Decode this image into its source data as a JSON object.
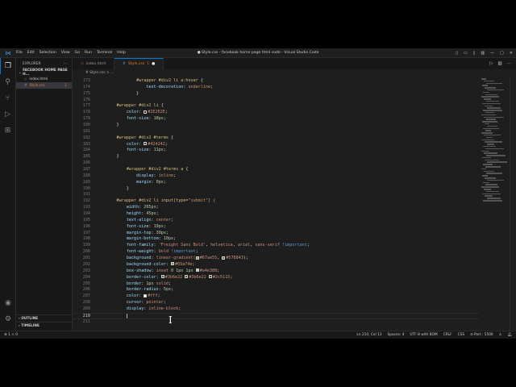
{
  "menu": [
    "File",
    "Edit",
    "Selection",
    "View",
    "Go",
    "Run",
    "Terminal",
    "Help"
  ],
  "window_title": "● Style.css - facebook home page html code - Visual Studio Code",
  "sidebar": {
    "title": "EXPLORER",
    "more": "···",
    "folder": "FACEBOOK HOME PAGE H...",
    "files": [
      {
        "name": "index.html",
        "icon": "◇"
      },
      {
        "name": "Style.css",
        "icon": "#",
        "badge": "1"
      }
    ],
    "outline": "OUTLINE",
    "timeline": "TIMELINE"
  },
  "tabs": [
    {
      "label": "index.html",
      "icon": "◇"
    },
    {
      "label": "Style.css",
      "badge": "1",
      "dirty": "●"
    }
  ],
  "breadcrumb": "# Style.css > ...",
  "code": [
    {
      "n": "173",
      "i": 16,
      "t": [
        [
          "#wrapper #div2 li a:hover ",
          "sel"
        ],
        [
          "{",
          "p"
        ]
      ]
    },
    {
      "n": "174",
      "i": 20,
      "t": [
        [
          "text-decoration",
          "prop"
        ],
        [
          ": ",
          "p"
        ],
        [
          "underline",
          "val"
        ],
        [
          ";",
          "p"
        ]
      ]
    },
    {
      "n": "175",
      "i": 16,
      "t": [
        [
          "}",
          "p"
        ]
      ]
    },
    {
      "n": "176",
      "i": 0,
      "t": []
    },
    {
      "n": "177",
      "i": 8,
      "t": [
        [
          "#wrapper #div2 li ",
          "sel"
        ],
        [
          "{",
          "p"
        ]
      ]
    },
    {
      "n": "178",
      "i": 12,
      "t": [
        [
          "color",
          "prop"
        ],
        [
          ": ",
          "p"
        ],
        [
          "#2E2E2E",
          "val",
          "#2E2E2E"
        ],
        [
          ";",
          "p"
        ]
      ]
    },
    {
      "n": "179",
      "i": 12,
      "t": [
        [
          "font-size",
          "prop"
        ],
        [
          ": ",
          "p"
        ],
        [
          "18px",
          "num"
        ],
        [
          ";",
          "p"
        ]
      ]
    },
    {
      "n": "180",
      "i": 8,
      "t": [
        [
          "}",
          "p"
        ]
      ]
    },
    {
      "n": "181",
      "i": 0,
      "t": []
    },
    {
      "n": "182",
      "i": 8,
      "t": [
        [
          "#wrapper #div2 #terms ",
          "sel"
        ],
        [
          "{",
          "p"
        ]
      ]
    },
    {
      "n": "183",
      "i": 12,
      "t": [
        [
          "color",
          "prop"
        ],
        [
          ": ",
          "p"
        ],
        [
          "#424242",
          "val",
          "#424242"
        ],
        [
          ";",
          "p"
        ]
      ]
    },
    {
      "n": "184",
      "i": 12,
      "t": [
        [
          "font-size",
          "prop"
        ],
        [
          ": ",
          "p"
        ],
        [
          "11px",
          "num"
        ],
        [
          ";",
          "p"
        ]
      ]
    },
    {
      "n": "185",
      "i": 8,
      "t": [
        [
          "}",
          "p"
        ]
      ]
    },
    {
      "n": "186",
      "i": 0,
      "t": []
    },
    {
      "n": "187",
      "i": 12,
      "t": [
        [
          "#wrapper #div2 #terms a ",
          "sel"
        ],
        [
          "{",
          "p"
        ]
      ]
    },
    {
      "n": "188",
      "i": 16,
      "t": [
        [
          "display",
          "prop"
        ],
        [
          ": ",
          "p"
        ],
        [
          "inline",
          "val"
        ],
        [
          ";",
          "p"
        ]
      ]
    },
    {
      "n": "189",
      "i": 16,
      "t": [
        [
          "margin",
          "prop"
        ],
        [
          ": ",
          "p"
        ],
        [
          "0px",
          "num"
        ],
        [
          ";",
          "p"
        ]
      ]
    },
    {
      "n": "190",
      "i": 12,
      "t": [
        [
          "}",
          "p"
        ]
      ]
    },
    {
      "n": "191",
      "i": 0,
      "t": []
    },
    {
      "n": "192",
      "i": 8,
      "t": [
        [
          "#wrapper #div2 li input",
          "sel"
        ],
        [
          "[type=",
          "sel"
        ],
        [
          "\"submit\"",
          "val"
        ],
        [
          "] ",
          "sel"
        ],
        [
          "{",
          "val"
        ]
      ]
    },
    {
      "n": "193",
      "i": 12,
      "t": [
        [
          "width",
          "prop"
        ],
        [
          ": ",
          "p"
        ],
        [
          "205px",
          "num"
        ],
        [
          ";",
          "p"
        ]
      ]
    },
    {
      "n": "194",
      "i": 12,
      "t": [
        [
          "height",
          "prop"
        ],
        [
          ": ",
          "p"
        ],
        [
          "45px",
          "num"
        ],
        [
          ";",
          "p"
        ]
      ]
    },
    {
      "n": "195",
      "i": 12,
      "t": [
        [
          "text-align",
          "prop"
        ],
        [
          ": ",
          "p"
        ],
        [
          "center",
          "val"
        ],
        [
          ";",
          "p"
        ]
      ]
    },
    {
      "n": "196",
      "i": 12,
      "t": [
        [
          "font-size",
          "prop"
        ],
        [
          ": ",
          "p"
        ],
        [
          "19px",
          "num"
        ],
        [
          ";",
          "p"
        ]
      ]
    },
    {
      "n": "197",
      "i": 12,
      "t": [
        [
          "margin-top",
          "prop"
        ],
        [
          ": ",
          "p"
        ],
        [
          "30px",
          "num"
        ],
        [
          ";",
          "p"
        ]
      ]
    },
    {
      "n": "198",
      "i": 12,
      "t": [
        [
          "margin-bottom",
          "prop"
        ],
        [
          ": ",
          "p"
        ],
        [
          "10px",
          "num"
        ],
        [
          ";",
          "p"
        ]
      ]
    },
    {
      "n": "199",
      "i": 12,
      "t": [
        [
          "font-family",
          "prop"
        ],
        [
          ": ",
          "p"
        ],
        [
          "'Freight Sans Bold'",
          "val"
        ],
        [
          ", ",
          "p"
        ],
        [
          "helvetica",
          "val"
        ],
        [
          ", ",
          "p"
        ],
        [
          "arial",
          "val"
        ],
        [
          ", ",
          "p"
        ],
        [
          "sans-serif",
          "val"
        ],
        [
          " ",
          "p"
        ],
        [
          "!important",
          "kw"
        ],
        [
          ";",
          "p"
        ]
      ]
    },
    {
      "n": "200",
      "i": 12,
      "t": [
        [
          "font-weight",
          "prop"
        ],
        [
          ": ",
          "p"
        ],
        [
          "bold",
          "val"
        ],
        [
          " ",
          "p"
        ],
        [
          "!important",
          "kw"
        ],
        [
          ";",
          "p"
        ]
      ]
    },
    {
      "n": "201",
      "i": 12,
      "t": [
        [
          "background",
          "prop"
        ],
        [
          ": ",
          "p"
        ],
        [
          "linear-gradient(",
          "val"
        ],
        [
          "#67ae55",
          "val",
          "#67ae55"
        ],
        [
          ", ",
          "p"
        ],
        [
          "#578843",
          "val",
          "#578843"
        ],
        [
          ");",
          "p"
        ]
      ]
    },
    {
      "n": "202",
      "i": 12,
      "t": [
        [
          "background-color",
          "prop"
        ],
        [
          ": ",
          "p"
        ],
        [
          "#69a74e",
          "val",
          "#69a74e"
        ],
        [
          ";",
          "p"
        ]
      ]
    },
    {
      "n": "203",
      "i": 12,
      "t": [
        [
          "box-shadow",
          "prop"
        ],
        [
          ": ",
          "p"
        ],
        [
          "inset ",
          "val"
        ],
        [
          "0 1px 1px ",
          "num"
        ],
        [
          "#a4e388",
          "val",
          "#a4e388"
        ],
        [
          ";",
          "p"
        ]
      ]
    },
    {
      "n": "204",
      "i": 12,
      "t": [
        [
          "border-color",
          "prop"
        ],
        [
          ": ",
          "p"
        ],
        [
          "#3b6e22",
          "val",
          "#3b6e22"
        ],
        [
          " ",
          "p"
        ],
        [
          "#3b6e22",
          "val",
          "#3b6e22"
        ],
        [
          " ",
          "p"
        ],
        [
          "#2c5115",
          "val",
          "#2c5115"
        ],
        [
          ";",
          "p"
        ]
      ]
    },
    {
      "n": "205",
      "i": 12,
      "t": [
        [
          "border",
          "prop"
        ],
        [
          ": ",
          "p"
        ],
        [
          "1px ",
          "num"
        ],
        [
          "solid",
          "val"
        ],
        [
          ";",
          "p"
        ]
      ]
    },
    {
      "n": "206",
      "i": 12,
      "t": [
        [
          "border-radius",
          "prop"
        ],
        [
          ": ",
          "p"
        ],
        [
          "5px",
          "num"
        ],
        [
          ";",
          "p"
        ]
      ]
    },
    {
      "n": "207",
      "i": 12,
      "t": [
        [
          "color",
          "prop"
        ],
        [
          ": ",
          "p"
        ],
        [
          "#fff",
          "val",
          "#ffffff"
        ],
        [
          ";",
          "p"
        ]
      ]
    },
    {
      "n": "208",
      "i": 12,
      "t": [
        [
          "cursor",
          "prop"
        ],
        [
          ": ",
          "p"
        ],
        [
          "pointer",
          "val"
        ],
        [
          ";",
          "p"
        ]
      ]
    },
    {
      "n": "209",
      "i": 12,
      "t": [
        [
          "display",
          "prop"
        ],
        [
          ": ",
          "p"
        ],
        [
          "inline-block",
          "val"
        ],
        [
          ";",
          "p"
        ]
      ]
    },
    {
      "n": "210",
      "i": 12,
      "t": [],
      "cursor": true
    },
    {
      "n": "211",
      "i": 0,
      "t": []
    }
  ],
  "status": {
    "problems": "⊗ 1 ⚠ 0",
    "position": "Ln 210, Col 13",
    "spaces": "Spaces: 4",
    "encoding": "UTF-8 with BOM",
    "eol": "CRLF",
    "language": "CSS",
    "port": "⊘ Port : 5500"
  },
  "colors": {
    "accent": "#0078d4",
    "modified": "#e37933"
  }
}
